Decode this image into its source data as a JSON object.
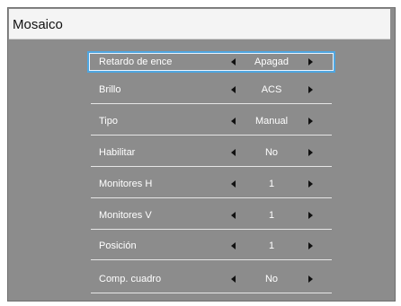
{
  "window": {
    "title": "Mosaico"
  },
  "menu": {
    "items": [
      {
        "label": "Retardo de ence",
        "value": "Apagad",
        "selected": true
      },
      {
        "label": "Brillo",
        "value": "ACS"
      },
      {
        "label": "Tipo",
        "value": "Manual"
      },
      {
        "label": "Habilitar",
        "value": "No"
      },
      {
        "label": "Monitores H",
        "value": "1"
      },
      {
        "label": "Monitores V",
        "value": "1"
      },
      {
        "label": "Posición",
        "value": "1"
      },
      {
        "label": "Comp. cuadro",
        "value": "No"
      }
    ]
  },
  "icons": {
    "left": "triangle-left-icon",
    "right": "triangle-right-icon"
  },
  "colors": {
    "panel": "#8c8c8c",
    "title_bar": "#f4f4f4",
    "selection": "#4fa6e0",
    "text": "#ffffff"
  }
}
